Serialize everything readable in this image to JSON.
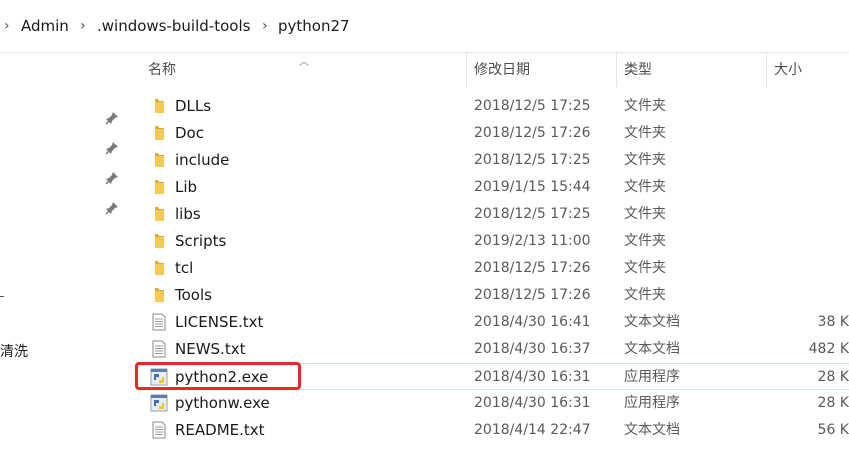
{
  "breadcrumb": {
    "items": [
      "Admin",
      ".windows-build-tools",
      "python27"
    ],
    "separator": "›"
  },
  "nav": {
    "label": "清洗"
  },
  "columns": {
    "name": "名称",
    "date": "修改日期",
    "type": "类型",
    "size": "大小"
  },
  "files": [
    {
      "name": "DLLs",
      "date": "2018/12/5 17:25",
      "type": "文件夹",
      "size": "",
      "icon": "folder-icon"
    },
    {
      "name": "Doc",
      "date": "2018/12/5 17:26",
      "type": "文件夹",
      "size": "",
      "icon": "folder-icon"
    },
    {
      "name": "include",
      "date": "2018/12/5 17:25",
      "type": "文件夹",
      "size": "",
      "icon": "folder-icon"
    },
    {
      "name": "Lib",
      "date": "2019/1/15 15:44",
      "type": "文件夹",
      "size": "",
      "icon": "folder-icon"
    },
    {
      "name": "libs",
      "date": "2018/12/5 17:25",
      "type": "文件夹",
      "size": "",
      "icon": "folder-icon"
    },
    {
      "name": "Scripts",
      "date": "2019/2/13 11:00",
      "type": "文件夹",
      "size": "",
      "icon": "folder-icon"
    },
    {
      "name": "tcl",
      "date": "2018/12/5 17:26",
      "type": "文件夹",
      "size": "",
      "icon": "folder-icon"
    },
    {
      "name": "Tools",
      "date": "2018/12/5 17:26",
      "type": "文件夹",
      "size": "",
      "icon": "folder-icon"
    },
    {
      "name": "LICENSE.txt",
      "date": "2018/4/30 16:41",
      "type": "文本文档",
      "size": "38 K",
      "icon": "text-file-icon"
    },
    {
      "name": "NEWS.txt",
      "date": "2018/4/30 16:37",
      "type": "文本文档",
      "size": "482 K",
      "icon": "text-file-icon"
    },
    {
      "name": "python2.exe",
      "date": "2018/4/30 16:31",
      "type": "应用程序",
      "size": "28 K",
      "icon": "python-exe-icon"
    },
    {
      "name": "pythonw.exe",
      "date": "2018/4/30 16:31",
      "type": "应用程序",
      "size": "28 K",
      "icon": "python-exe-icon"
    },
    {
      "name": "README.txt",
      "date": "2018/4/14 22:47",
      "type": "文本文档",
      "size": "56 K",
      "icon": "text-file-icon"
    }
  ],
  "colors": {
    "folder": "#f0c24b",
    "highlight": "#e82a2a",
    "selection_border": "#cde8f4"
  }
}
